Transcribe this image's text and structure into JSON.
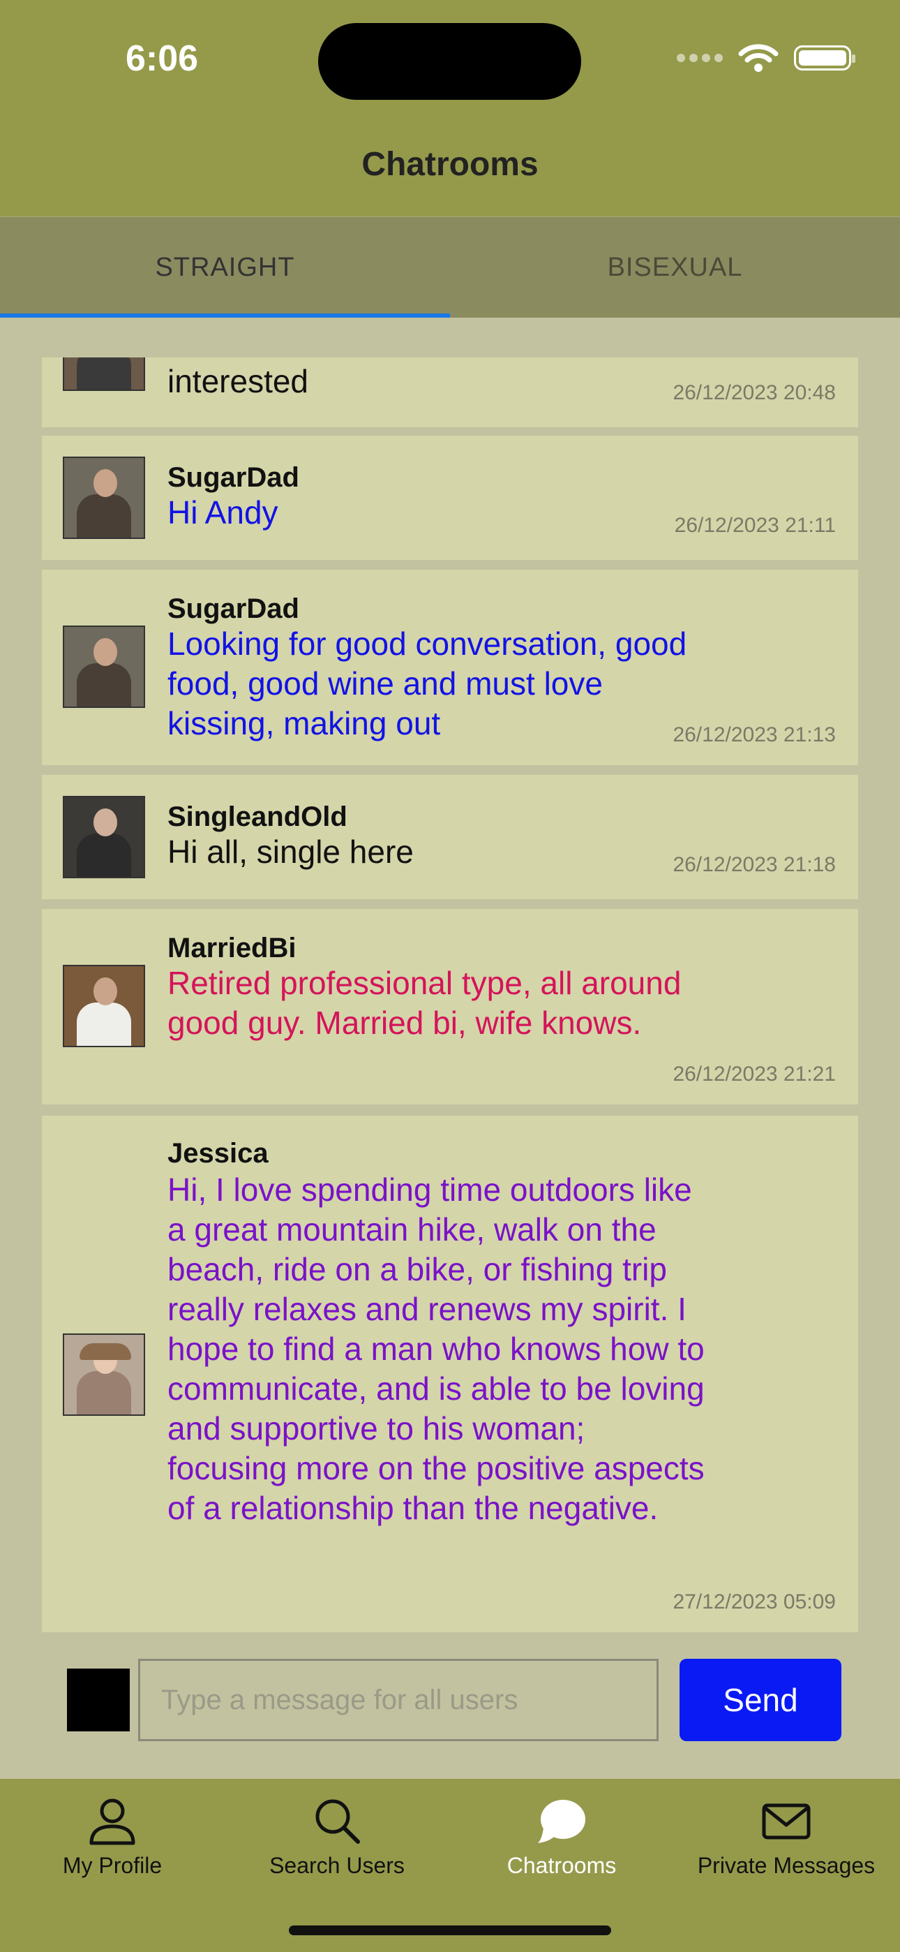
{
  "status_bar": {
    "time": "6:06"
  },
  "header": {
    "title": "Chatrooms"
  },
  "tabs": [
    {
      "label": "STRAIGHT",
      "active": true
    },
    {
      "label": "BISEXUAL",
      "active": false
    }
  ],
  "messages": [
    {
      "username": "",
      "text": "interested",
      "timestamp": "26/12/2023 20:48",
      "color": "#111111"
    },
    {
      "username": "SugarDad",
      "text": "Hi Andy",
      "timestamp": "26/12/2023 21:11",
      "color": "#1212e6"
    },
    {
      "username": "SugarDad",
      "text": "Looking for good conversation, good food, good wine and must love kissing, making out",
      "timestamp": "26/12/2023 21:13",
      "color": "#1212e6"
    },
    {
      "username": "SingleandOld",
      "text": "Hi all, single here",
      "timestamp": "26/12/2023 21:18",
      "color": "#111111"
    },
    {
      "username": "MarriedBi",
      "text": "Retired professional type, all around good guy. Married bi, wife knows.",
      "timestamp": "26/12/2023 21:21",
      "color": "#d4145a"
    },
    {
      "username": "Jessica",
      "text": "Hi, I love spending time outdoors like a great mountain hike, walk on the beach, ride on a bike, or fishing trip really relaxes and renews my spirit. I hope to find a man who knows how to communicate, and is able to be loving and supportive to his woman; focusing more on the positive aspects of a relationship than the negative.",
      "timestamp": "27/12/2023 05:09",
      "color": "#7a12c8"
    }
  ],
  "composer": {
    "placeholder": "Type a message for all users",
    "send_label": "Send",
    "swatch_color": "#000000"
  },
  "tabbar": [
    {
      "label": "My Profile",
      "icon": "person-icon"
    },
    {
      "label": "Search Users",
      "icon": "search-icon"
    },
    {
      "label": "Chatrooms",
      "icon": "chat-bubble-icon",
      "active": true
    },
    {
      "label": "Private Messages",
      "icon": "envelope-icon"
    }
  ]
}
